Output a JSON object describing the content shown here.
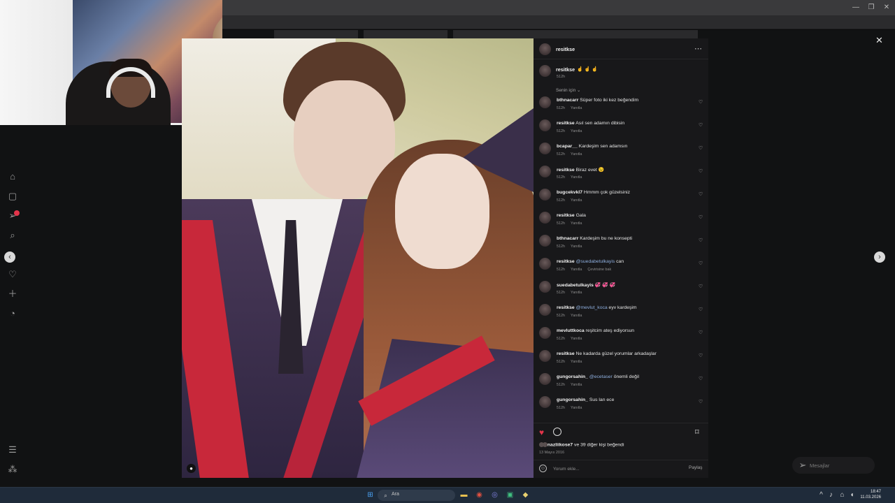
{
  "browser": {
    "tab_icons": [
      "minimize-icon",
      "restore-icon",
      "close-icon"
    ]
  },
  "post": {
    "author": "resitkse",
    "caption": "☝ ☝ ☝",
    "caption_time": "512h",
    "section_label": "Senin için ⌄",
    "likes_text_user": "nazliikose7",
    "likes_text_rest": " ve 39 diğer kişi beğendi",
    "date": "13 Mayıs 2016",
    "add_comment_placeholder": "Yorum ekle...",
    "share_label": "Paylaş",
    "reply_label": "Yanıtla",
    "translate_label": "Çevirisine bak"
  },
  "comments": [
    {
      "user": "bthnacarr",
      "pre": " Süper foto iki kez beğendim",
      "mention": "",
      "post": "",
      "time": "512h",
      "translate": false
    },
    {
      "user": "resitkse",
      "pre": " Asıl sen adamın dibisin",
      "mention": "",
      "post": "",
      "time": "512h",
      "translate": false
    },
    {
      "user": "bcapar__",
      "pre": " Kardeşim sen adamsın",
      "mention": "",
      "post": "",
      "time": "512h",
      "translate": false
    },
    {
      "user": "resitkse",
      "pre": " Biraz evet 😉",
      "mention": "",
      "post": "",
      "time": "512h",
      "translate": false
    },
    {
      "user": "bugcekvkl7",
      "pre": " Hmmm çok güzelsiniz",
      "mention": "",
      "post": "",
      "time": "512h",
      "translate": false
    },
    {
      "user": "resitkse",
      "pre": " Gala",
      "mention": "",
      "post": "",
      "time": "512h",
      "translate": false
    },
    {
      "user": "bthnacarr",
      "pre": " Kardeşim bu ne konsepti",
      "mention": "",
      "post": "",
      "time": "512h",
      "translate": false
    },
    {
      "user": "resitkse",
      "pre": " ",
      "mention": "@suedabetulkayis",
      "post": " can",
      "time": "512h",
      "translate": true
    },
    {
      "user": "suedabetulkayis",
      "pre": " 💞 💞 💞",
      "mention": "",
      "post": "",
      "time": "512h",
      "translate": false
    },
    {
      "user": "resitkse",
      "pre": " ",
      "mention": "@mevlut_koca",
      "post": " eyv kardeşim",
      "time": "512h",
      "translate": false
    },
    {
      "user": "mevluttkoca",
      "pre": " reşitcim ateş ediyorsun",
      "mention": "",
      "post": "",
      "time": "512h",
      "translate": false
    },
    {
      "user": "resitkse",
      "pre": " Ne kadarda güzel yorumlar arkadaşlar",
      "mention": "",
      "post": "",
      "time": "512h",
      "translate": false
    },
    {
      "user": "gungorsahin_",
      "pre": " ",
      "mention": "@ecetaser",
      "post": " önemli değil",
      "time": "512h",
      "translate": false
    },
    {
      "user": "gungorsahin_",
      "pre": " Sus lan ece",
      "mention": "",
      "post": "",
      "time": "512h",
      "translate": false
    }
  ],
  "messages": {
    "label": "Mesajlar"
  },
  "taskbar": {
    "search": "Ara",
    "time": "18:47",
    "date": "11.03.2026"
  },
  "colors": {
    "like": "#e3344a",
    "panel": "#18181a",
    "mention": "#8fb0e0"
  }
}
